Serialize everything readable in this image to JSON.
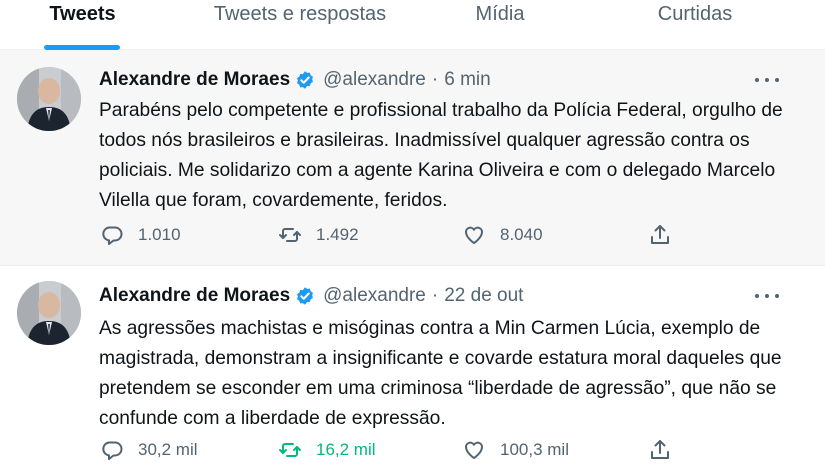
{
  "tabs": [
    {
      "label": "Tweets",
      "active": true
    },
    {
      "label": "Tweets e respostas",
      "active": false
    },
    {
      "label": "Mídia",
      "active": false
    },
    {
      "label": "Curtidas",
      "active": false
    }
  ],
  "colors": {
    "accent": "#1d9bf0",
    "retweet_active": "#00ba7c",
    "secondary_text": "#536471"
  },
  "tweets": [
    {
      "author_name": "Alexandre de Moraes",
      "verified_icon": "verified-badge-icon",
      "handle": "@alexandre",
      "separator": "·",
      "time": "6 min",
      "text": "Parabéns pelo competente e profissional trabalho da Polícia Federal, orgulho de todos nós brasileiros e brasileiras. Inadmissível qualquer agressão contra os policiais. Me solidarizo com a agente Karina Oliveira e com o delegado Marcelo Vilella que foram, covardemente, feridos.",
      "replies": "1.010",
      "retweets": "1.492",
      "retweeted": false,
      "likes": "8.040"
    },
    {
      "author_name": "Alexandre de Moraes",
      "verified_icon": "verified-badge-icon",
      "handle": "@alexandre",
      "separator": "·",
      "time": "22 de out",
      "text": "As agressões machistas e misóginas contra a Min Carmen Lúcia, exemplo de magistrada, demonstram a insignificante e covarde estatura moral daqueles que pretendem se esconder em uma criminosa “liberdade de agressão”, que não se confunde com a liberdade de expressão.",
      "replies": "30,2 mil",
      "retweets": "16,2 mil",
      "retweeted": true,
      "likes": "100,3 mil"
    }
  ]
}
